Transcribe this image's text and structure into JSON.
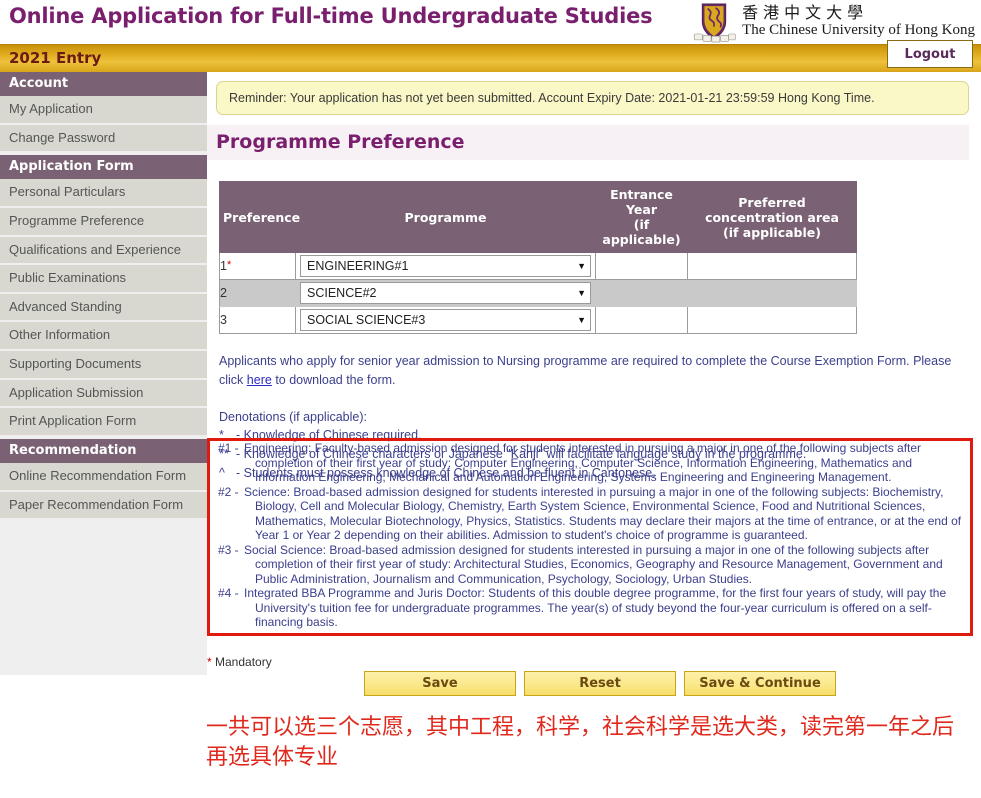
{
  "header": {
    "title": "Online Application for Full-time Undergraduate Studies",
    "university_cn": "香港中文大學",
    "university_en": "The Chinese University of Hong Kong",
    "entry_label": "2021 Entry",
    "logout_label": "Logout"
  },
  "sidebar": {
    "sections": [
      {
        "heading": "Account",
        "items": [
          "My Application",
          "Change Password"
        ]
      },
      {
        "heading": "Application Form",
        "items": [
          "Personal Particulars",
          "Programme Preference",
          "Qualifications and Experience",
          "Public Examinations",
          "Advanced Standing",
          "Other Information",
          "Supporting Documents",
          "Application Submission",
          "Print Application Form"
        ]
      },
      {
        "heading": "Recommendation",
        "items": [
          "Online Recommendation Form",
          "Paper Recommendation Form"
        ]
      }
    ]
  },
  "main": {
    "reminder": "Reminder: Your application has not yet been submitted. Account Expiry Date: 2021-01-21 23:59:59 Hong Kong Time.",
    "page_title": "Programme Preference",
    "table": {
      "columns": [
        "Preference",
        "Programme",
        "Entrance Year (if applicable)",
        "Preferred concentration area (if applicable)"
      ],
      "column_lines": [
        [
          "Preference"
        ],
        [
          "Programme"
        ],
        [
          "Entrance Year",
          "(if applicable)"
        ],
        [
          "Preferred concentration area",
          "(if applicable)"
        ]
      ],
      "rows": [
        {
          "no": "1",
          "required": "*",
          "programme": "ENGINEERING#1",
          "entrance_year": "",
          "concentration": ""
        },
        {
          "no": "2",
          "required": "",
          "programme": "SCIENCE#2",
          "entrance_year": "",
          "concentration": ""
        },
        {
          "no": "3",
          "required": "",
          "programme": "SOCIAL SCIENCE#3",
          "entrance_year": "",
          "concentration": ""
        }
      ],
      "dropdown_arrow": "▼"
    },
    "nursing_note_before": "Applicants who apply for senior year admission to Nursing programme are required to complete the Course Exemption Form. Please click",
    "nursing_link": "here",
    "nursing_note_after": "to download the form.",
    "denotations_heading": "Denotations (if applicable):",
    "denotations": [
      {
        "symbol": "*",
        "text": "- Knowledge of Chinese required."
      },
      {
        "symbol": "**",
        "text": "- Knowledge of Chinese characters or Japanese \"Kanji\" will facilitate language study in the programme."
      },
      {
        "symbol": "^",
        "text": "- Students must possess knowledge of Chinese and be fluent in Cantonese."
      }
    ],
    "programme_notes": [
      {
        "key": "#1 -",
        "text": "Engineering: Faculty-based admission designed for students interested in pursuing a major in one of the following subjects after completion of their first year of study: Computer Engineering, Computer Science, Information Engineering, Mathematics and Information Engineering, Mechanical and Automation Engineering, Systems Engineering and Engineering Management."
      },
      {
        "key": "#2 -",
        "text": "Science: Broad-based admission designed for students interested in pursuing a major in one of the following subjects: Biochemistry, Biology, Cell and Molecular Biology, Chemistry, Earth System Science, Environmental Science, Food and Nutritional Sciences, Mathematics, Molecular Biotechnology, Physics, Statistics. Students may declare their majors at the time of entrance, or at the end of Year 1 or Year 2 depending on their abilities. Admission to student's choice of programme is guaranteed."
      },
      {
        "key": "#3 -",
        "text": "Social Science: Broad-based admission designed for students interested in pursuing a major in one of the following subjects after completion of their first year of study: Architectural Studies, Economics, Geography and Resource Management, Government and Public Administration, Journalism and Communication, Psychology, Sociology, Urban Studies."
      },
      {
        "key": "#4 -",
        "text": "Integrated BBA Programme and Juris Doctor: Students of this double degree programme, for the first four years of study, will pay the University's tuition fee for undergraduate programmes. The year(s) of study beyond the four-year curriculum is offered on a self-financing basis."
      }
    ],
    "mandatory_symbol": "*",
    "mandatory_label": "Mandatory",
    "buttons": [
      "Save",
      "Reset",
      "Save & Continue"
    ],
    "chinese_annotation": "一共可以选三个志愿，其中工程，科学，社会科学是选大类，读完第一年之后再选具体专业"
  },
  "colors": {
    "brand_purple": "#7a1f6e",
    "header_bar_purple": "#7a6274",
    "gold": "#dca71a",
    "annotation_red": "#e01b0e",
    "note_blue": "#3b3f8c"
  }
}
